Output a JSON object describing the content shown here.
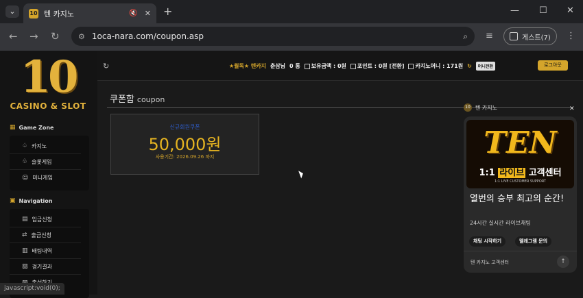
{
  "browser": {
    "tab_title": "텐 카지노",
    "tab_favicon": "10",
    "url": "1oca-nara.com/coupon.asp",
    "guest_label": "게스트(7)"
  },
  "sidebar": {
    "logo_number": "10",
    "logo_text": "CASINO & SLOT",
    "game_zone": {
      "title": "Game Zone",
      "items": [
        {
          "label": "카지노",
          "icon": "spade-icon"
        },
        {
          "label": "슬롯게임",
          "icon": "slot-icon"
        },
        {
          "label": "미니게임",
          "icon": "gamepad-icon"
        }
      ]
    },
    "navigation": {
      "title": "Navigation",
      "items": [
        {
          "label": "입금신청",
          "icon": "deposit-icon"
        },
        {
          "label": "출금신청",
          "icon": "withdraw-icon"
        },
        {
          "label": "배팅내역",
          "icon": "history-icon"
        },
        {
          "label": "경기결과",
          "icon": "result-icon"
        },
        {
          "label": "출석하기",
          "icon": "calendar-icon"
        }
      ]
    }
  },
  "topbar": {
    "notice": "★월독★ 텐카지",
    "user": "춘삼님",
    "messages": "0 통",
    "balance": "보유금액 : 0원",
    "points": "포인트 : 0원 [전환]",
    "casino_money": "카지노머니 : 171원",
    "mini_button": "머니전환",
    "logout": "로그아웃"
  },
  "coupon": {
    "title": "쿠폰함",
    "subtitle": "coupon",
    "card": {
      "label": "신규회원쿠폰",
      "amount": "50,000원",
      "expiry": "사용기간: 2026.09.26 까지"
    }
  },
  "widget": {
    "brand": "텐 카지노",
    "banner_big": "TEN",
    "banner_sub_prefix": "1:1 ",
    "banner_sub_highlight": "라이브",
    "banner_sub_suffix": " 고객센터",
    "banner_tiny": "1:1 LIVE CUSTOMER SUPPORT",
    "title": "열번의 승부 최고의 순간!",
    "desc": "24시간 실시간 라이브채팅",
    "buttons": [
      "채팅 시작하기",
      "텔레그램 문의"
    ],
    "footer": "텐 카지노 고객센터"
  },
  "status_text": "javascript:void(0);",
  "colors": {
    "gold": "#d4a52b",
    "amount": "#e6b421",
    "label_blue": "#2f5fd0"
  }
}
